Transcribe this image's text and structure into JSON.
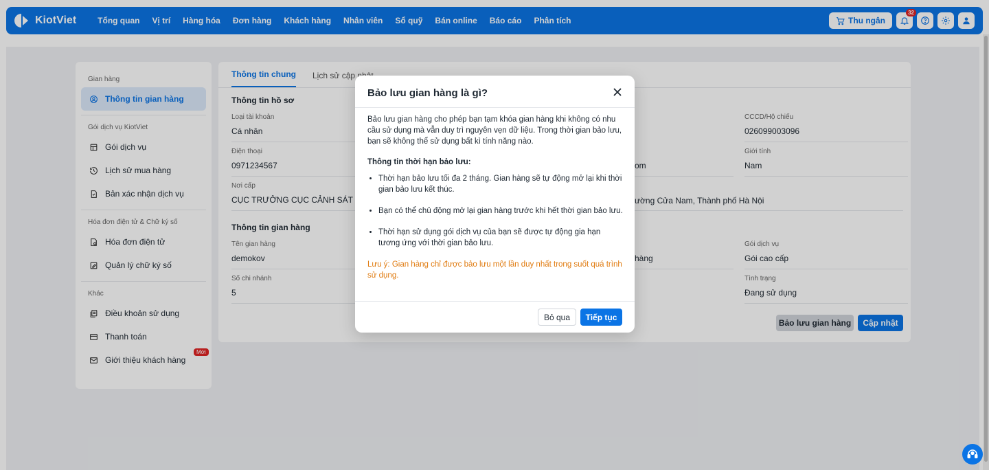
{
  "app": {
    "brand": "KiotViet"
  },
  "nav": [
    "Tổng quan",
    "Vị trí",
    "Hàng hóa",
    "Đơn hàng",
    "Khách hàng",
    "Nhân viên",
    "Sổ quỹ",
    "Bán online",
    "Báo cáo",
    "Phân tích"
  ],
  "toolbar": {
    "cashier_label": "Thu ngân",
    "notification_count": "32"
  },
  "sidebar": {
    "groups": [
      {
        "title": "Gian hàng",
        "items": [
          {
            "label": "Thông tin gian hàng",
            "icon": "user-circle-icon"
          }
        ]
      },
      {
        "title": "Gói dịch vụ KiotViet",
        "items": [
          {
            "label": "Gói dịch vụ",
            "icon": "store-icon"
          },
          {
            "label": "Lịch sử mua hàng",
            "icon": "history-icon"
          },
          {
            "label": "Bản xác nhận dịch vụ",
            "icon": "document-icon"
          }
        ]
      },
      {
        "title": "Hóa đơn điện tử & Chữ ký số",
        "items": [
          {
            "label": "Hóa đơn điện tử",
            "icon": "invoice-icon"
          },
          {
            "label": "Quản lý chữ ký số",
            "icon": "signature-icon"
          }
        ]
      },
      {
        "title": "Khác",
        "items": [
          {
            "label": "Điều khoản sử dụng",
            "icon": "terms-icon"
          },
          {
            "label": "Thanh toán",
            "icon": "card-icon"
          },
          {
            "label": "Giới thiệu khách hàng",
            "icon": "mail-icon",
            "badge": "Mới"
          }
        ]
      }
    ]
  },
  "main": {
    "tabs": [
      "Thông tin chung",
      "Lịch sử cập nhật"
    ],
    "profile_title": "Thông tin hồ sơ",
    "store_title": "Thông tin gian hàng",
    "fields": {
      "account_type": {
        "label": "Loại tài khoản",
        "value": "Cá nhân"
      },
      "id_card": {
        "label": "CCCD/Hộ chiếu",
        "value": "026099003096"
      },
      "phone": {
        "label": "Điện thoại",
        "value": "0971234567"
      },
      "email_partial": {
        "value": "om"
      },
      "gender": {
        "label": "Giới tính",
        "value": "Nam"
      },
      "issued_by": {
        "label": "Nơi cấp",
        "value": "CỤC TRƯỞNG CỤC CẢNH SÁT QU"
      },
      "address_partial": {
        "value": "ường Cửa Nam, Thành phố Hà Nội"
      },
      "store_name": {
        "label": "Tên gian hàng",
        "value": "demokov"
      },
      "industry_partial": {
        "value": "hàng"
      },
      "service_pack": {
        "label": "Gói dịch vụ",
        "value": "Gói cao cấp"
      },
      "branch_count": {
        "label": "Số chi nhánh",
        "value": "5"
      },
      "status": {
        "label": "Tình trạng",
        "value": "Đang sử dụng"
      }
    },
    "reserve_button": "Bảo lưu gian hàng",
    "update_button": "Cập nhật"
  },
  "modal": {
    "title": "Bảo lưu gian hàng là gì?",
    "intro": "Bảo lưu gian hàng cho phép bạn tạm khóa gian hàng khi không có nhu cầu sử dụng mà vẫn duy trì nguyên vẹn dữ liệu. Trong thời gian bảo lưu, bạn sẽ không thể sử dụng bất kì tính năng nào.",
    "subtitle": "Thông tin thời hạn bảo lưu:",
    "bullets": [
      "Thời hạn bảo lưu tối đa 2 tháng. Gian hàng sẽ tự động mở lại khi thời gian bảo lưu kết thúc.",
      "Bạn có thể chủ động mở lại gian hàng trước khi hết thời gian bảo lưu.",
      "Thời hạn sử dụng gói dịch vụ của bạn sẽ được tự động gia hạn tương ứng với thời gian bảo lưu."
    ],
    "note": "Lưu ý: Gian hàng chỉ được bảo lưu một lần duy nhất trong suốt quá trình sử dụng.",
    "skip_label": "Bỏ qua",
    "continue_label": "Tiếp tục"
  },
  "colors": {
    "primary": "#0b74e5",
    "note": "#e07b10",
    "badge": "#e02424"
  }
}
